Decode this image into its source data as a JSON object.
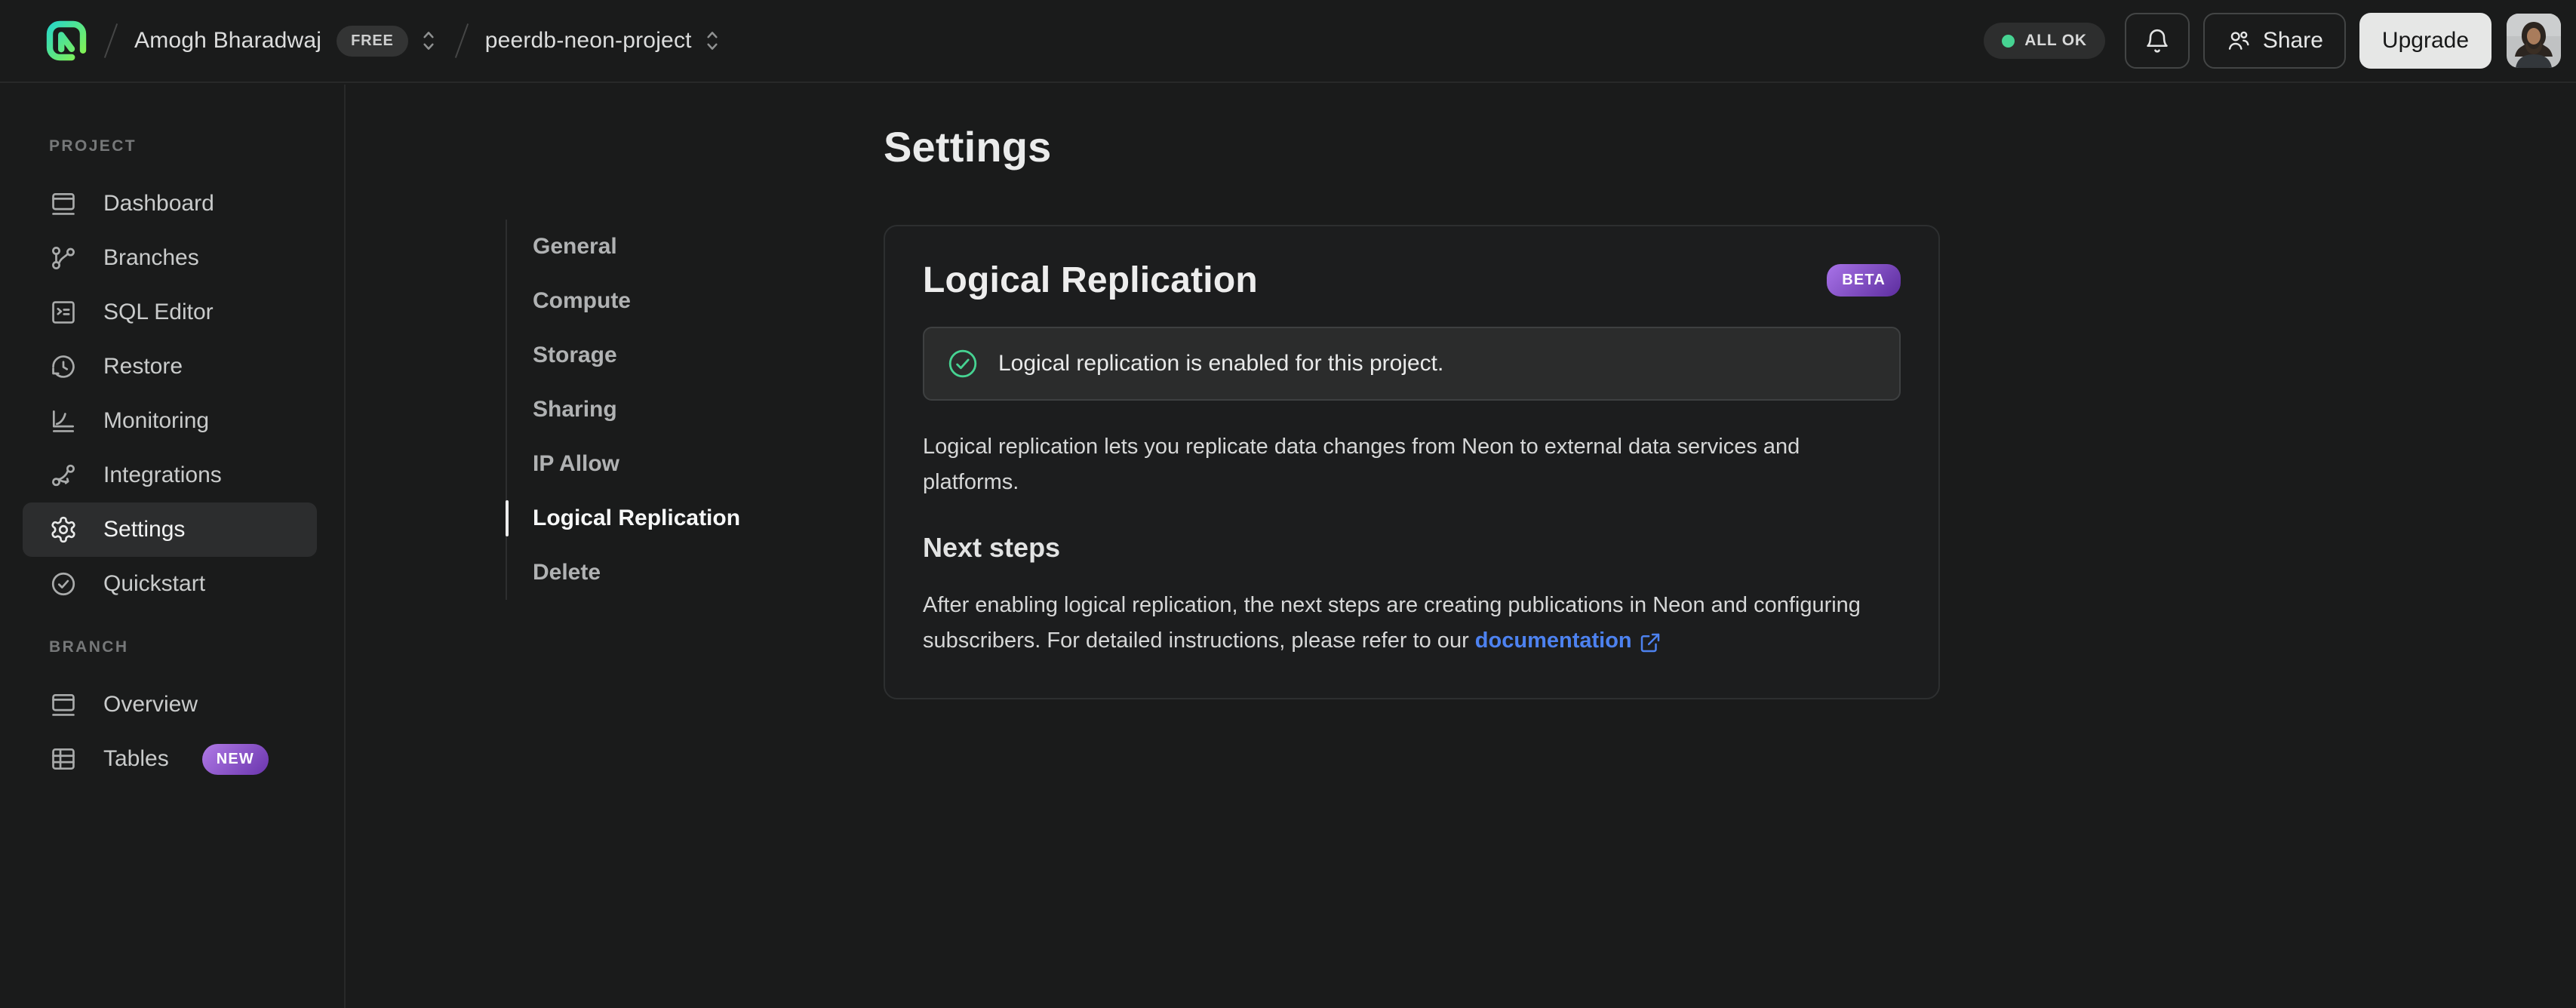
{
  "topbar": {
    "breadcrumb": {
      "org": "Amogh Bharadwaj",
      "plan_badge": "FREE",
      "project": "peerdb-neon-project"
    },
    "status": {
      "label": "ALL OK"
    },
    "share_label": "Share",
    "upgrade_label": "Upgrade"
  },
  "sidebar": {
    "sections": [
      {
        "label": "PROJECT",
        "items": [
          {
            "label": "Dashboard"
          },
          {
            "label": "Branches"
          },
          {
            "label": "SQL Editor"
          },
          {
            "label": "Restore"
          },
          {
            "label": "Monitoring"
          },
          {
            "label": "Integrations"
          },
          {
            "label": "Settings",
            "active": true
          },
          {
            "label": "Quickstart"
          }
        ]
      },
      {
        "label": "BRANCH",
        "items": [
          {
            "label": "Overview"
          },
          {
            "label": "Tables",
            "badge": "NEW"
          }
        ]
      }
    ]
  },
  "settings_nav": {
    "items": [
      {
        "label": "General"
      },
      {
        "label": "Compute"
      },
      {
        "label": "Storage"
      },
      {
        "label": "Sharing"
      },
      {
        "label": "IP Allow"
      },
      {
        "label": "Logical Replication",
        "active": true
      },
      {
        "label": "Delete"
      }
    ]
  },
  "main": {
    "page_title": "Settings",
    "card": {
      "title": "Logical Replication",
      "beta_badge": "BETA",
      "banner_text": "Logical replication is enabled for this project.",
      "description": "Logical replication lets you replicate data changes from Neon to external data services and platforms.",
      "next_steps": {
        "title": "Next steps",
        "text_before_link": "After enabling logical replication, the next steps are creating publications in Neon and configuring subscribers. For detailed instructions, please refer to our ",
        "link_label": "documentation"
      }
    }
  },
  "colors": {
    "background": "#1a1b1b",
    "border": "#282929",
    "accent_green": "#46d392",
    "link_blue": "#4d82f0",
    "badge_purple_start": "#a873e8",
    "badge_purple_end": "#5c2d9e",
    "upgrade_button_bg": "#e6e7e6",
    "logo_gradient_start": "#29d8c5",
    "logo_gradient_end": "#86f24e"
  }
}
